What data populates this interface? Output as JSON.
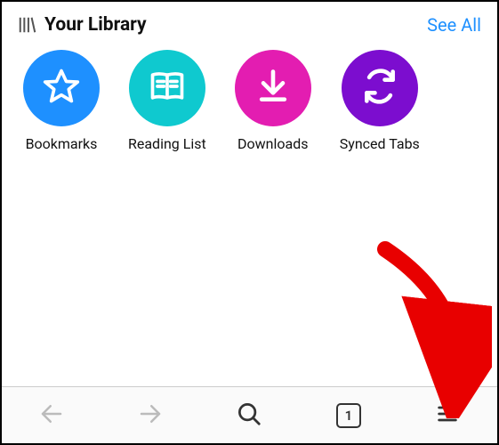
{
  "header": {
    "title": "Your Library",
    "see_all": "See All"
  },
  "library": {
    "items": [
      {
        "label": "Bookmarks",
        "icon": "star-icon",
        "color": "#1e90ff"
      },
      {
        "label": "Reading List",
        "icon": "book-icon",
        "color": "#0fc9cf"
      },
      {
        "label": "Downloads",
        "icon": "download-icon",
        "color": "#e31db1"
      },
      {
        "label": "Synced Tabs",
        "icon": "sync-icon",
        "color": "#7c0dcf"
      }
    ]
  },
  "toolbar": {
    "back_enabled": false,
    "forward_enabled": false,
    "tab_count": "1"
  }
}
